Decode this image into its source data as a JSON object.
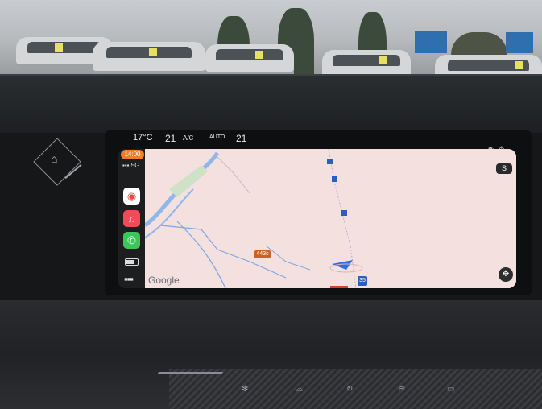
{
  "climate": {
    "temperature": "17°C",
    "fan_left": "21",
    "ac_label": "A/C",
    "auto_label": "AUTO",
    "fan_right": "21"
  },
  "carplay": {
    "time": "14:00",
    "signal": "5G",
    "apps": [
      {
        "name": "maps",
        "color": "#ffffff",
        "icon": "maps-icon"
      },
      {
        "name": "music",
        "color": "#f24b58",
        "icon": "music-icon"
      },
      {
        "name": "phone",
        "color": "#3bc55a",
        "icon": "phone-icon"
      }
    ]
  },
  "map": {
    "attribution": "Google",
    "road_labels": [
      {
        "text": "443c",
        "color": "#d4601c"
      },
      {
        "text": "35",
        "color": "#2d5dbd"
      }
    ],
    "mode_badge": "S"
  }
}
